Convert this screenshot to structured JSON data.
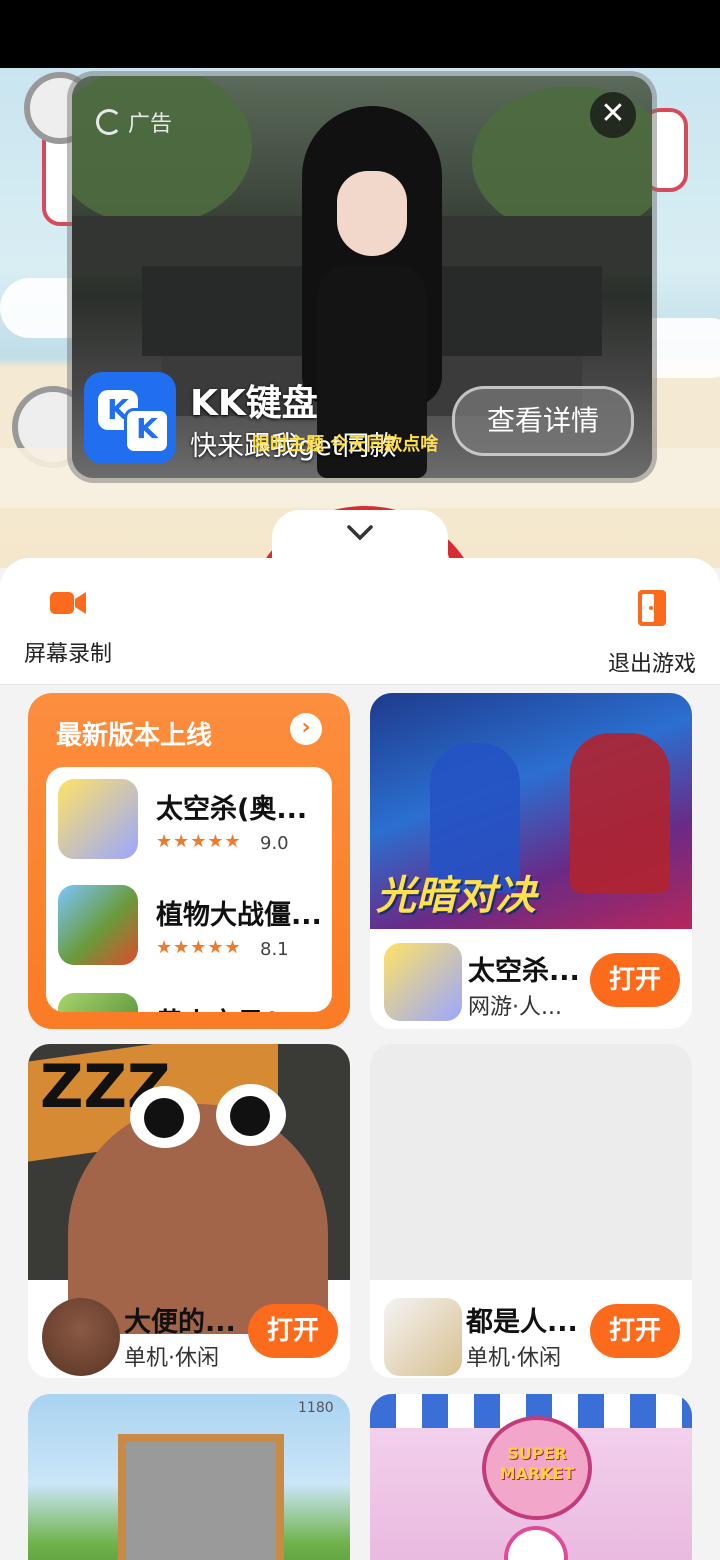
{
  "colors": {
    "accent": "#fc6a1c",
    "ad_button": "#1f6ff0"
  },
  "ad": {
    "label": "广告",
    "title": "KK键盘",
    "subtitle": "快来跟我get同款",
    "caption": "限时主题 今天同款点啥",
    "cta": "查看详情",
    "close_icon": "close-icon"
  },
  "collapse_icon": "chevron-down-icon",
  "toolbar": {
    "record": {
      "label": "屏幕录制",
      "icon": "video-camera-icon"
    },
    "exit": {
      "label": "退出游戏",
      "icon": "exit-door-icon"
    }
  },
  "newest": {
    "title": "最新版本上线",
    "items": [
      {
        "name": "太空杀(奥...",
        "stars": "★★★★★",
        "score": "9.0"
      },
      {
        "name": "植物大战僵...",
        "stars": "★★★★★",
        "score": "8.1"
      },
      {
        "name": "黄火宝贝(",
        "stars": "",
        "score": ""
      }
    ]
  },
  "cards": [
    {
      "name": "太空杀...",
      "tag": "网游·人...",
      "button": "打开",
      "banner_text": "光暗对决"
    },
    {
      "name": "大便的...",
      "tag": "单机·休闲",
      "button": "打开",
      "banner_text": "ZZZ"
    },
    {
      "name": "都是人...",
      "tag": "单机·休闲",
      "button": "打开",
      "banner_text": ""
    }
  ],
  "bottom_tiles": {
    "left_counter": "1180",
    "right_sign": "SUPER MARKET"
  }
}
